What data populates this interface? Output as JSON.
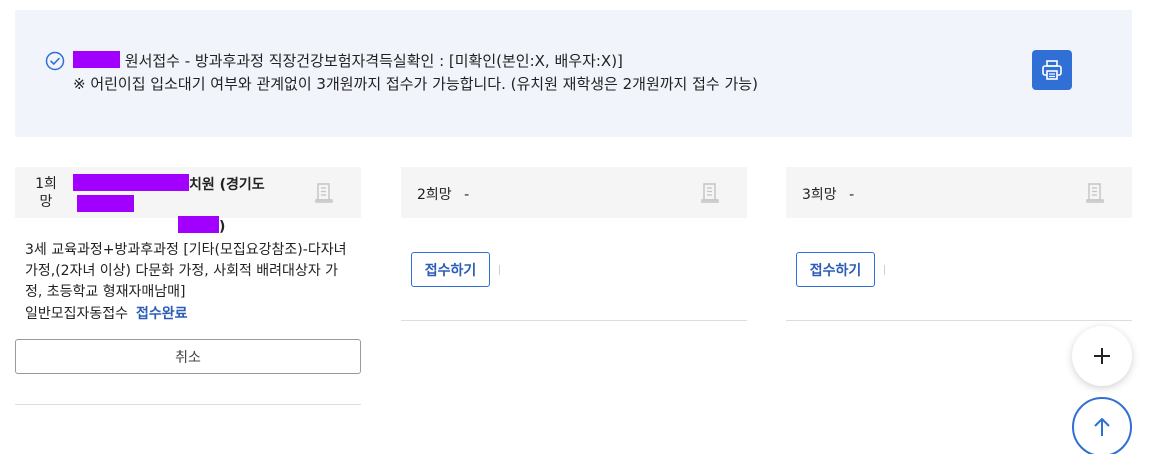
{
  "notice": {
    "line1_text": "원서접수 - 방과후과정 직장건강보험자격득실확인 : [미확인(본인:X, 배우자:X)]",
    "line2_text": "※ 어린이집 입소대기 여부와 관계없이 3개원까지 접수가 가능합니다. (유치원 재학생은 2개원까지 접수 가능)",
    "print_icon": "printer-icon"
  },
  "choices": [
    {
      "rank": "1희망",
      "school_suffix": "치원 (경기도",
      "school_close": ")",
      "description": "3세 교육과정+방과후과정 [기타(모집요강참조)-다자녀 가정,(2자녀 이상) 다문화 가정, 사회적 배려대상자 가정, 초등학교 형재자매남매]",
      "method": "일반모집자동접수",
      "status": "접수완료",
      "cancel_label": "취소"
    },
    {
      "rank": "2희망",
      "school": "-",
      "apply_label": "접수하기"
    },
    {
      "rank": "3희망",
      "school": "-",
      "apply_label": "접수하기"
    }
  ],
  "colors": {
    "accent": "#2f6fd6",
    "status_blue": "#2b5cb8",
    "notice_bg": "#f1f4fb",
    "redaction": "#a100ff"
  }
}
